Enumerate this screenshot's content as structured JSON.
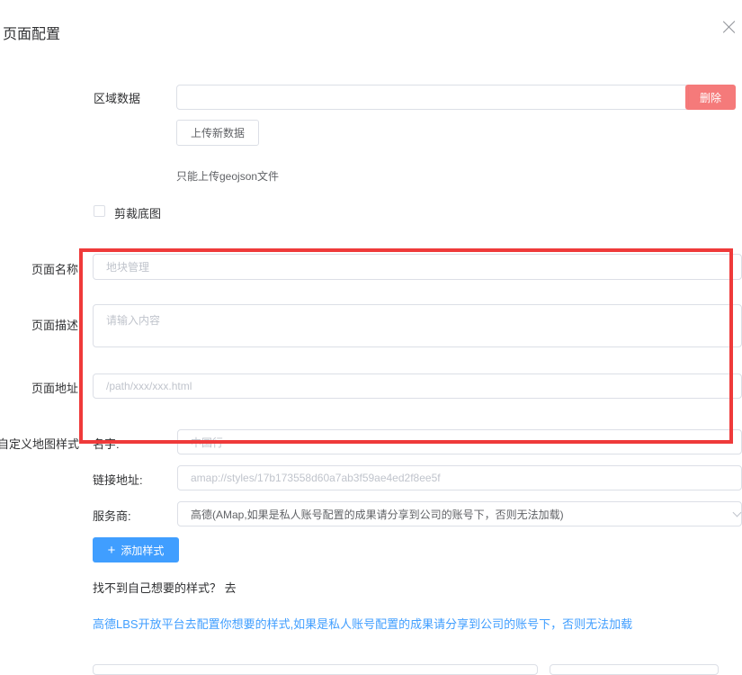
{
  "dialog": {
    "title": "页面配置"
  },
  "region": {
    "label": "区域数据",
    "input_value": "",
    "delete_label": "删除",
    "upload_label": "上传新数据",
    "upload_hint": "只能上传geojson文件",
    "crop_label": "剪裁底图",
    "crop_checked": false
  },
  "page": {
    "name_label": "页面名称",
    "name_placeholder": "地块管理",
    "desc_label": "页面描述",
    "desc_placeholder": "请输入内容",
    "url_label": "页面地址",
    "url_placeholder": "/path/xxx/xxx.html"
  },
  "map_style": {
    "section_label": "自定义地图样式",
    "name_label": "名字:",
    "name_value": "中国行",
    "link_label": "链接地址:",
    "link_placeholder": "amap://styles/17b173558d60a7ab3f59ae4ed2f8ee5f",
    "provider_label": "服务商:",
    "provider_value": "高德(AMap,如果是私人账号配置的成果请分享到公司的账号下，否则无法加载)",
    "add_label": "添加样式",
    "not_found_text": "找不到自己想要的样式？ 去",
    "amap_link": "高德LBS开放平台去配置你想要的样式,如果是私人账号配置的成果请分享到公司的账号下，否则无法加载"
  },
  "colors": {
    "primary": "#409eff",
    "danger": "#f56c6c",
    "highlight": "#ef3a3a"
  }
}
